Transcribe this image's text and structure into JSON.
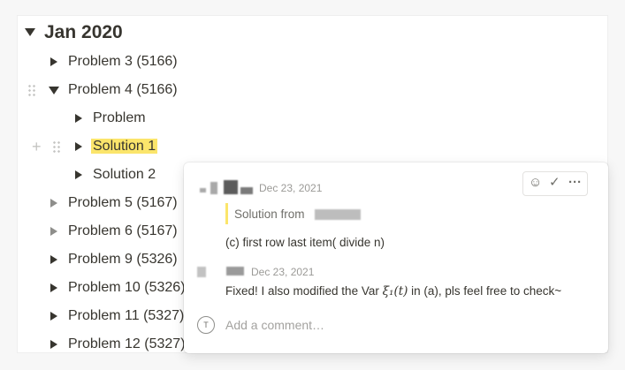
{
  "toggle_list": {
    "heading": "Jan 2020",
    "items": [
      {
        "label": "Problem 3 (5166)",
        "state": "collapsed"
      },
      {
        "label": "Problem 4 (5166)",
        "state": "expanded"
      },
      {
        "label": "Problem",
        "state": "collapsed"
      },
      {
        "label": "Solution 1",
        "state": "collapsed",
        "highlighted": true
      },
      {
        "label": "Solution 2",
        "state": "collapsed"
      },
      {
        "label": "Problem 5 (5167)",
        "state": "collapsed"
      },
      {
        "label": "Problem 6 (5167)",
        "state": "collapsed"
      },
      {
        "label": "Problem 9 (5326)",
        "state": "collapsed"
      },
      {
        "label": "Problem 10 (5326)",
        "state": "collapsed"
      },
      {
        "label": "Problem 11 (5327)",
        "state": "collapsed"
      },
      {
        "label": "Problem 12 (5327)",
        "state": "collapsed"
      }
    ]
  },
  "comment_popup": {
    "comments": [
      {
        "date": "Dec 23, 2021",
        "quote": "Solution from",
        "text": "(c) first row last item( divide n)"
      },
      {
        "date": "Dec 23, 2021",
        "text_before": "Fixed! I also modified the Var ",
        "math": "ξ₁(t)",
        "text_after": " in (a), pls feel free to check~"
      }
    ],
    "add_comment_placeholder": "Add a comment…",
    "avatar_initial": "T"
  },
  "colors": {
    "highlight": "#fbe56b",
    "text": "#37352f",
    "muted": "#9b9a97"
  }
}
